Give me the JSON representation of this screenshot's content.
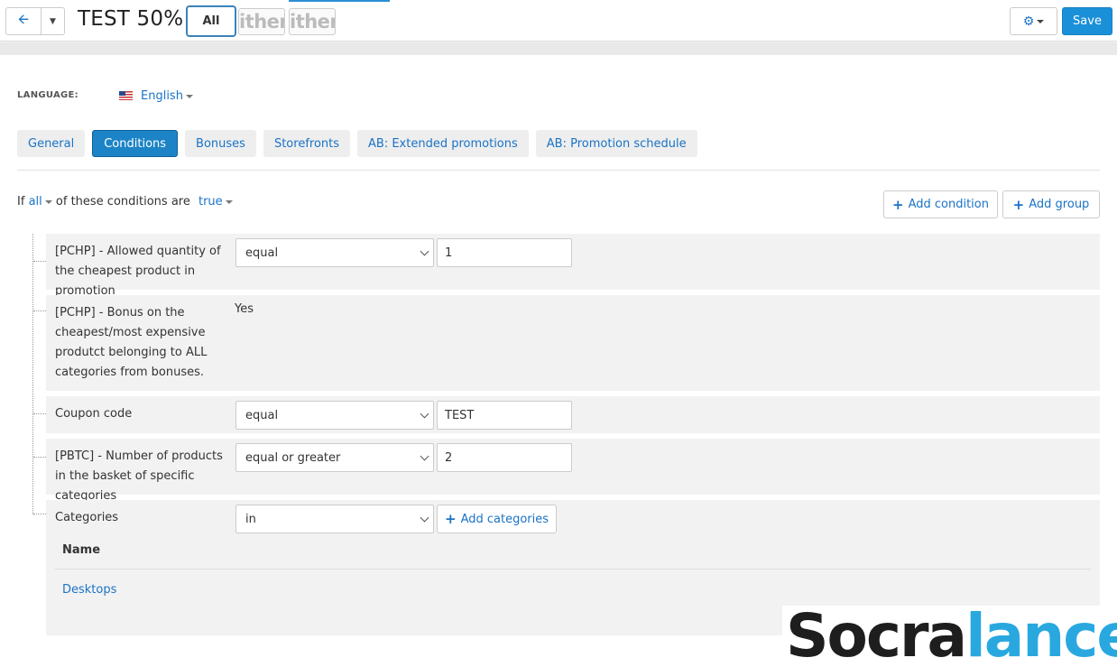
{
  "header": {
    "title": "TEST 50%",
    "storefront_all_label": "All",
    "storefront_logo_a": "ither",
    "storefront_logo_b": "ither",
    "save_label": "Save"
  },
  "language": {
    "label": "LANGUAGE:",
    "value": "English"
  },
  "tabs": [
    {
      "label": "General",
      "active": false
    },
    {
      "label": "Conditions",
      "active": true
    },
    {
      "label": "Bonuses",
      "active": false
    },
    {
      "label": "Storefronts",
      "active": false
    },
    {
      "label": "AB: Extended promotions",
      "active": false
    },
    {
      "label": "AB: Promotion schedule",
      "active": false
    }
  ],
  "conditions_header": {
    "prefix": "If",
    "match": "all",
    "middle": "of these conditions are",
    "value": "true",
    "add_condition_label": "Add condition",
    "add_group_label": "Add group"
  },
  "conditions": [
    {
      "label": "[PCHP] - Allowed quantity of the cheapest product in promotion",
      "operator": "equal",
      "value": "1"
    },
    {
      "label": "[PCHP] - Bonus on the cheapest/most expensive produtct belonging to ALL categories from bonuses.",
      "value_text": "Yes"
    },
    {
      "label": "Coupon code",
      "operator": "equal",
      "value": "TEST"
    },
    {
      "label": "[PBTC] - Number of products in the basket of specific categories",
      "operator": "equal or greater",
      "value": "2"
    },
    {
      "label": "Categories",
      "operator": "in",
      "add_categories_label": "Add categories",
      "table_header": "Name",
      "items": [
        "Desktops"
      ]
    }
  ],
  "watermark": {
    "part1": "Socra",
    "part2": "lance"
  },
  "colors": {
    "accent": "#1a73c6",
    "primary_button": "#1a90d9",
    "active_tab": "#1c84c6",
    "row_bg": "#f2f2f2"
  }
}
